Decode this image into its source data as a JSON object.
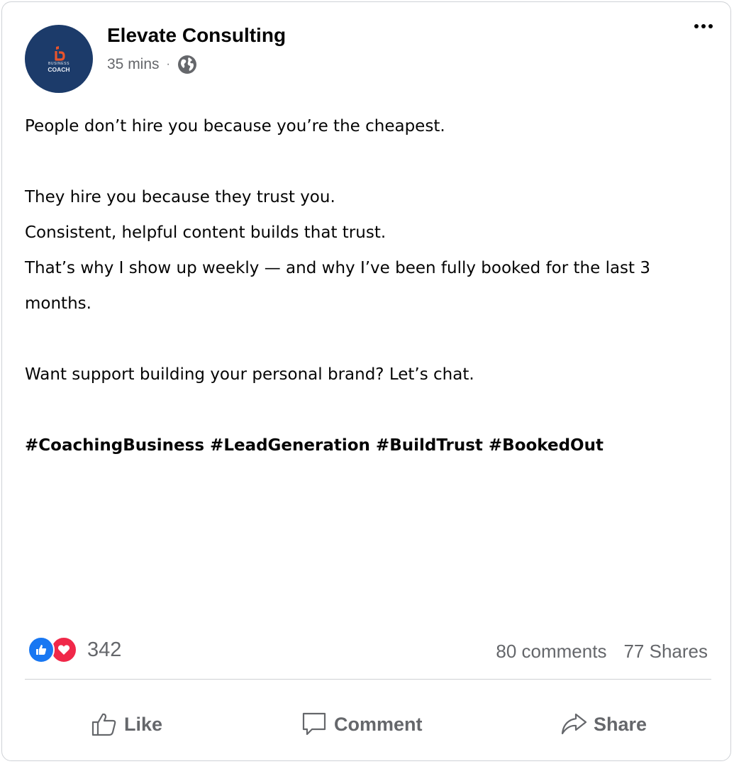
{
  "post_header": {
    "author_name": "Elevate Consulting",
    "avatar_logo_small": "BUSINESS",
    "avatar_logo_big": "COACH",
    "timestamp": "35 mins",
    "separator": "·",
    "audience_icon": "globe-icon",
    "more_icon": "more-options-icon"
  },
  "post_body": {
    "line1": "People don’t hire you because you’re the cheapest.",
    "line2": "They hire you because they trust you.",
    "line3": "Consistent, helpful content builds that trust.",
    "line4": "That’s why I show up weekly — and why I’ve been fully booked for the last 3 months.",
    "line5": "Want support building your personal brand? Let’s chat.",
    "hashtags": "#CoachingBusiness #LeadGeneration #BuildTrust #BookedOut"
  },
  "engagement": {
    "reaction_icons": [
      "like-reaction-icon",
      "love-reaction-icon"
    ],
    "reaction_count": "342",
    "comments": "80 comments",
    "shares": "77 Shares"
  },
  "actions": {
    "like": "Like",
    "comment": "Comment",
    "share": "Share"
  },
  "colors": {
    "avatar_bg": "#1c3b6a",
    "logo_accent": "#e8542c",
    "like_blue": "#1877f2",
    "love_red": "#f02849",
    "muted_text": "#65676b"
  }
}
